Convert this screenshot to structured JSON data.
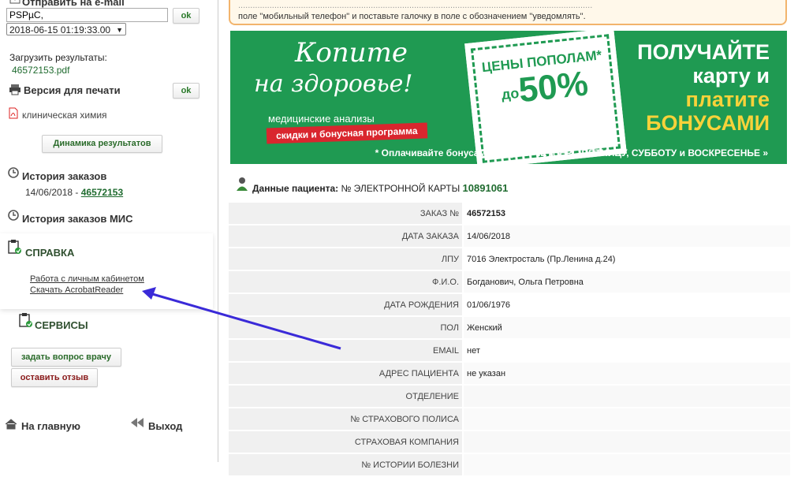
{
  "sidebar": {
    "send_email_label": "Отправить на e-mail",
    "email_value": "PSPµС,",
    "datetime_value": "2018-06-15 01:19:33.00",
    "ok_label": "ok",
    "download_results_label": "Загрузить результаты:",
    "pdf_link": "46572153.pdf",
    "print_version_label": "Версия для печати",
    "clinical_chem_label": "клиническая химия",
    "dynamics_button": "Динамика результатов",
    "order_history_label": "История заказов",
    "order_history_date": "14/06/2018 - ",
    "order_history_link": "46572153",
    "mis_history_label": "История заказов МИС",
    "help_title": "СПРАВКА",
    "help_links": [
      "Работа с личным кабинетом",
      "Скачать AcrobatReader"
    ],
    "services_title": "СЕРВИСЫ",
    "ask_doctor_button": "задать вопрос врачу",
    "leave_review_button": "оставить отзыв",
    "home_label": "На главную",
    "exit_label": "Выход"
  },
  "notice": {
    "line1": "...................................................................................................................................................",
    "line2": "поле \"мобильный телефон\" и поставьте галочку в поле с обозначением \"уведомлять\"."
  },
  "banner": {
    "copy1": "Копите",
    "copy2": "на здоровье!",
    "med": "медицинские анализы",
    "program": "скидки и бонусная программа",
    "badge1": "ЦЕНЫ ПОПОЛАМ*",
    "badge_pre": "до",
    "badge2": "50%",
    "right1": "ПОЛУЧАЙТЕ",
    "right2": "карту и",
    "right3": "платите",
    "right4": "БОНУСАМИ",
    "footer": "* Оплачивайте бонусами каждый ЧЕТВЕРГ, ПЯТНИЦУ, СУББОТУ и ВОСКРЕСЕНЬЕ »"
  },
  "patient": {
    "title": "Данные пациента:",
    "card_label": " № ЭЛЕКТРОННОЙ КАРТЫ ",
    "card_number": "10891061",
    "rows": [
      {
        "label": "ЗАКАЗ №",
        "value": "46572153"
      },
      {
        "label": "ДАТА ЗАКАЗА",
        "value": "14/06/2018"
      },
      {
        "label": "ЛПУ",
        "value": "7016 Электросталь (Пр.Ленина д.24)"
      },
      {
        "label": "Ф.И.О.",
        "value": "Богданович, Ольга Петровна"
      },
      {
        "label": "ДАТА РОЖДЕНИЯ",
        "value": "01/06/1976"
      },
      {
        "label": "ПОЛ",
        "value": "Женский"
      },
      {
        "label": "EMAIL",
        "value": "нет"
      },
      {
        "label": "АДРЕС ПАЦИЕНТА",
        "value": "не указан"
      },
      {
        "label": "ОТДЕЛЕНИЕ",
        "value": ""
      },
      {
        "label": "№ СТРАХОВОГО ПОЛИСА",
        "value": ""
      },
      {
        "label": "СТРАХОВАЯ КОМПАНИЯ",
        "value": ""
      },
      {
        "label": "№ ИСТОРИИ БОЛЕЗНИ",
        "value": ""
      }
    ]
  },
  "colors": {
    "banner_green": "#1f9a52",
    "accent_yellow": "#f8d23a",
    "arrow": "#3a2ad8",
    "notice_border": "#f2b46c"
  }
}
